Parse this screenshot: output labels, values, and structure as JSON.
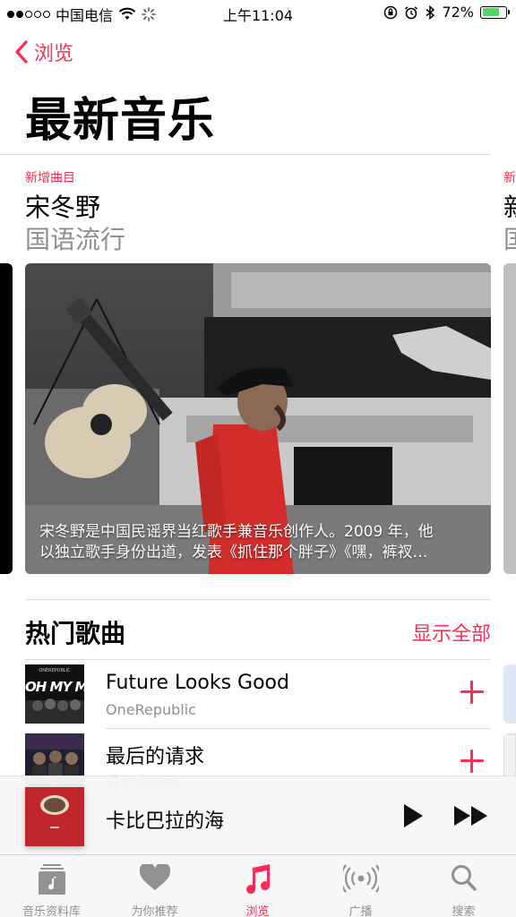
{
  "status_bar": {
    "carrier": "中国电信",
    "time": "上午11:04",
    "battery": "72%",
    "battery_level": 0.72
  },
  "nav": {
    "back_label": "浏览",
    "title": "最新音乐"
  },
  "featured": {
    "tag": "新增曲目",
    "title": "宋冬野",
    "subtitle": "国语流行",
    "caption_line1": "宋冬野是中国民谣界当红歌手兼音乐创作人。2009 年，他",
    "caption_line2": "以独立歌手身份出道，发表《抓住那个胖子》《嘿，裤衩…",
    "next_tag": "新",
    "next_title": "新",
    "next_subtitle": "国"
  },
  "hot_songs": {
    "title": "热门歌曲",
    "show_all": "显示全部",
    "items": [
      {
        "title": "Future Looks Good",
        "artist": "OneRepublic",
        "art_text": "OH MY MY",
        "art_small": "ONEREPUBLIC"
      },
      {
        "title": "最后的请求",
        "artist": "猫子会唱回",
        "art_text": ""
      }
    ]
  },
  "mini_player": {
    "title": "卡比巴拉的海"
  },
  "tabs": [
    {
      "label": "音乐资料库",
      "icon": "library-icon",
      "active": false
    },
    {
      "label": "为你推荐",
      "icon": "heart-icon",
      "active": false
    },
    {
      "label": "浏览",
      "icon": "music-note-icon",
      "active": true
    },
    {
      "label": "广播",
      "icon": "radio-icon",
      "active": false
    },
    {
      "label": "搜索",
      "icon": "search-icon",
      "active": false
    }
  ],
  "colors": {
    "accent": "#ff2d55",
    "secondary_text": "#8e8e93",
    "battery_green": "#4cd964"
  }
}
